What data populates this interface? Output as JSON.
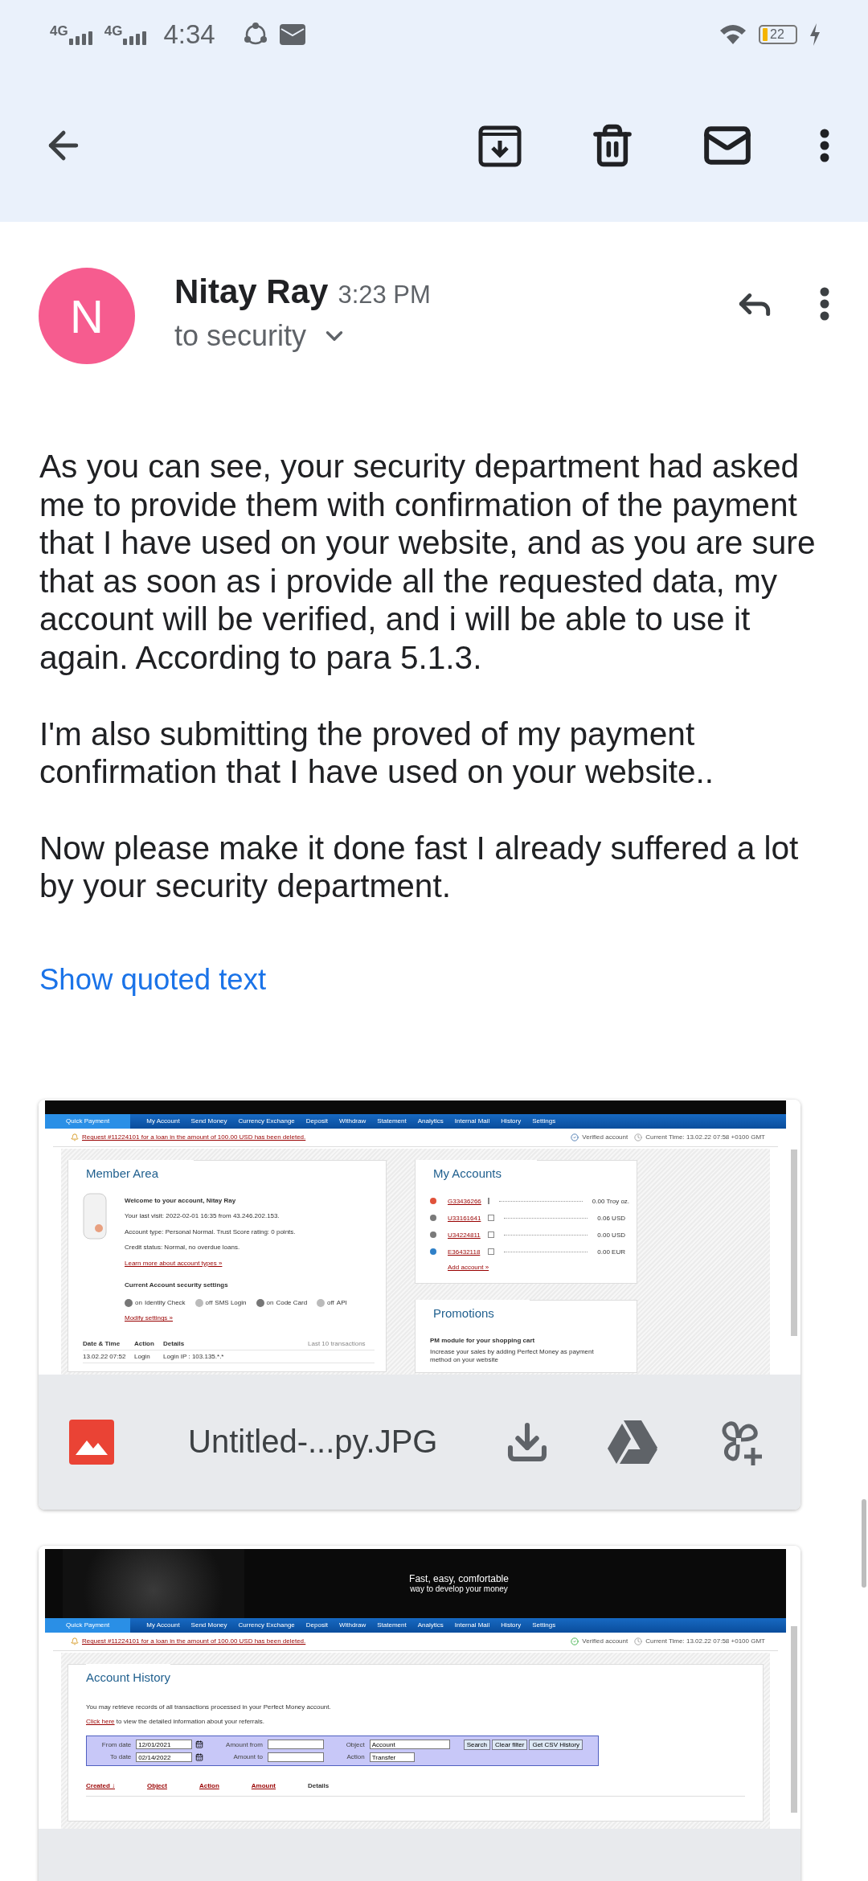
{
  "status_bar": {
    "networks": [
      "4G",
      "4G"
    ],
    "time": "4:34",
    "battery": "22"
  },
  "message": {
    "sender": {
      "initial": "N",
      "name": "Nitay Ray",
      "time": "3:23 PM",
      "recipient": "to security"
    },
    "body": [
      "As you can see, your security department had asked me to provide them with confirmation of the payment that I have used on your website, and as you are sure that as soon as i provide all the requested data, my account will be verified, and i will be able to use it again. According to para 5.1.3.",
      "I'm also submitting the proved of my payment confirmation that I have used on your website..",
      "Now please make it done fast I already suffered a lot by your security department."
    ],
    "show_quoted": "Show quoted text"
  },
  "attachments": [
    {
      "kind": "member_area",
      "filename": "Untitled-...py.JPG",
      "preview": {
        "nav": [
          "Quick Payment",
          "My Account",
          "Send Money",
          "Currency Exchange",
          "Deposit",
          "Withdraw",
          "Statement",
          "Analytics",
          "Internal Mail",
          "History",
          "Settings"
        ],
        "alert": "Request #11224101 for a loan in the amount of 100.00 USD has been deleted.",
        "verified": "Verified account",
        "current_time": "Current Time: 13.02.22 07:58 +0100 GMT",
        "member_area": {
          "title": "Member Area",
          "welcome": "Welcome to your account, Nitay Ray",
          "lines": [
            "Your last visit: 2022-02-01 16:35 from 43.246.202.153.",
            "Account type: Personal Normal. Trust Score rating: 0 points.",
            "Credit status: Normal, no overdue loans."
          ],
          "learn_more": "Learn more about account types »",
          "security_title": "Current Account security settings",
          "settings": [
            {
              "state": "on",
              "label": "Identity Check"
            },
            {
              "state": "off",
              "label": "SMS Login"
            },
            {
              "state": "on",
              "label": "Code Card"
            },
            {
              "state": "off",
              "label": "API"
            }
          ],
          "modify": "Modify settings »",
          "columns": [
            "Date & Time",
            "Action",
            "Details"
          ],
          "table_note": "Last 10 transactions",
          "rows": [
            [
              "13.02.22 07:52",
              "Login",
              "Login IP : 103.135.*.*"
            ]
          ]
        },
        "accounts": {
          "title": "My Accounts",
          "items": [
            {
              "id": "G33436266",
              "amount": "0.00 Troy oz.",
              "color": "#e0523a"
            },
            {
              "id": "U33161641",
              "amount": "0.06 USD",
              "color": "#7a7a7a"
            },
            {
              "id": "U34224811",
              "amount": "0.00 USD",
              "color": "#7a7a7a"
            },
            {
              "id": "E36432118",
              "amount": "0.00 EUR",
              "color": "#2f80c8"
            }
          ],
          "add": "Add account »"
        },
        "promotions": {
          "title": "Promotions",
          "heading": "PM module for your shopping cart",
          "text": "Increase your sales by adding Perfect Money as payment method on your website"
        }
      }
    },
    {
      "kind": "account_history",
      "preview": {
        "banner_title": "Fast, easy, comfortable",
        "banner_subtitle": "way to develop your money",
        "nav": [
          "Quick Payment",
          "My Account",
          "Send Money",
          "Currency Exchange",
          "Deposit",
          "Withdraw",
          "Statement",
          "Analytics",
          "Internal Mail",
          "History",
          "Settings"
        ],
        "alert": "Request #11224101 for a loan in the amount of 100.00 USD has been deleted.",
        "verified": "Verified account",
        "current_time": "Current Time: 13.02.22 07:58 +0100 GMT",
        "title": "Account History",
        "intro": "You may retrieve records of all transactions processed in your Perfect Money account.",
        "referral_link": "Click here",
        "referral_text": " to view the detailed information about your referrals.",
        "filter": {
          "from_label": "From date",
          "from_value": "12/01/2021",
          "to_label": "To date",
          "to_value": "02/14/2022",
          "amount_from": "Amount from",
          "amount_to": "Amount to",
          "object_label": "Object",
          "object_value": "Account",
          "action_label": "Action",
          "action_value": "Transfer",
          "buttons": [
            "Search",
            "Clear filter",
            "Get CSV History"
          ]
        },
        "columns": [
          {
            "label": "Created ↓",
            "sortable": true
          },
          {
            "label": "Object",
            "sortable": true
          },
          {
            "label": "Action",
            "sortable": true
          },
          {
            "label": "Amount",
            "sortable": true
          },
          {
            "label": "Details",
            "sortable": false
          }
        ]
      }
    }
  ]
}
